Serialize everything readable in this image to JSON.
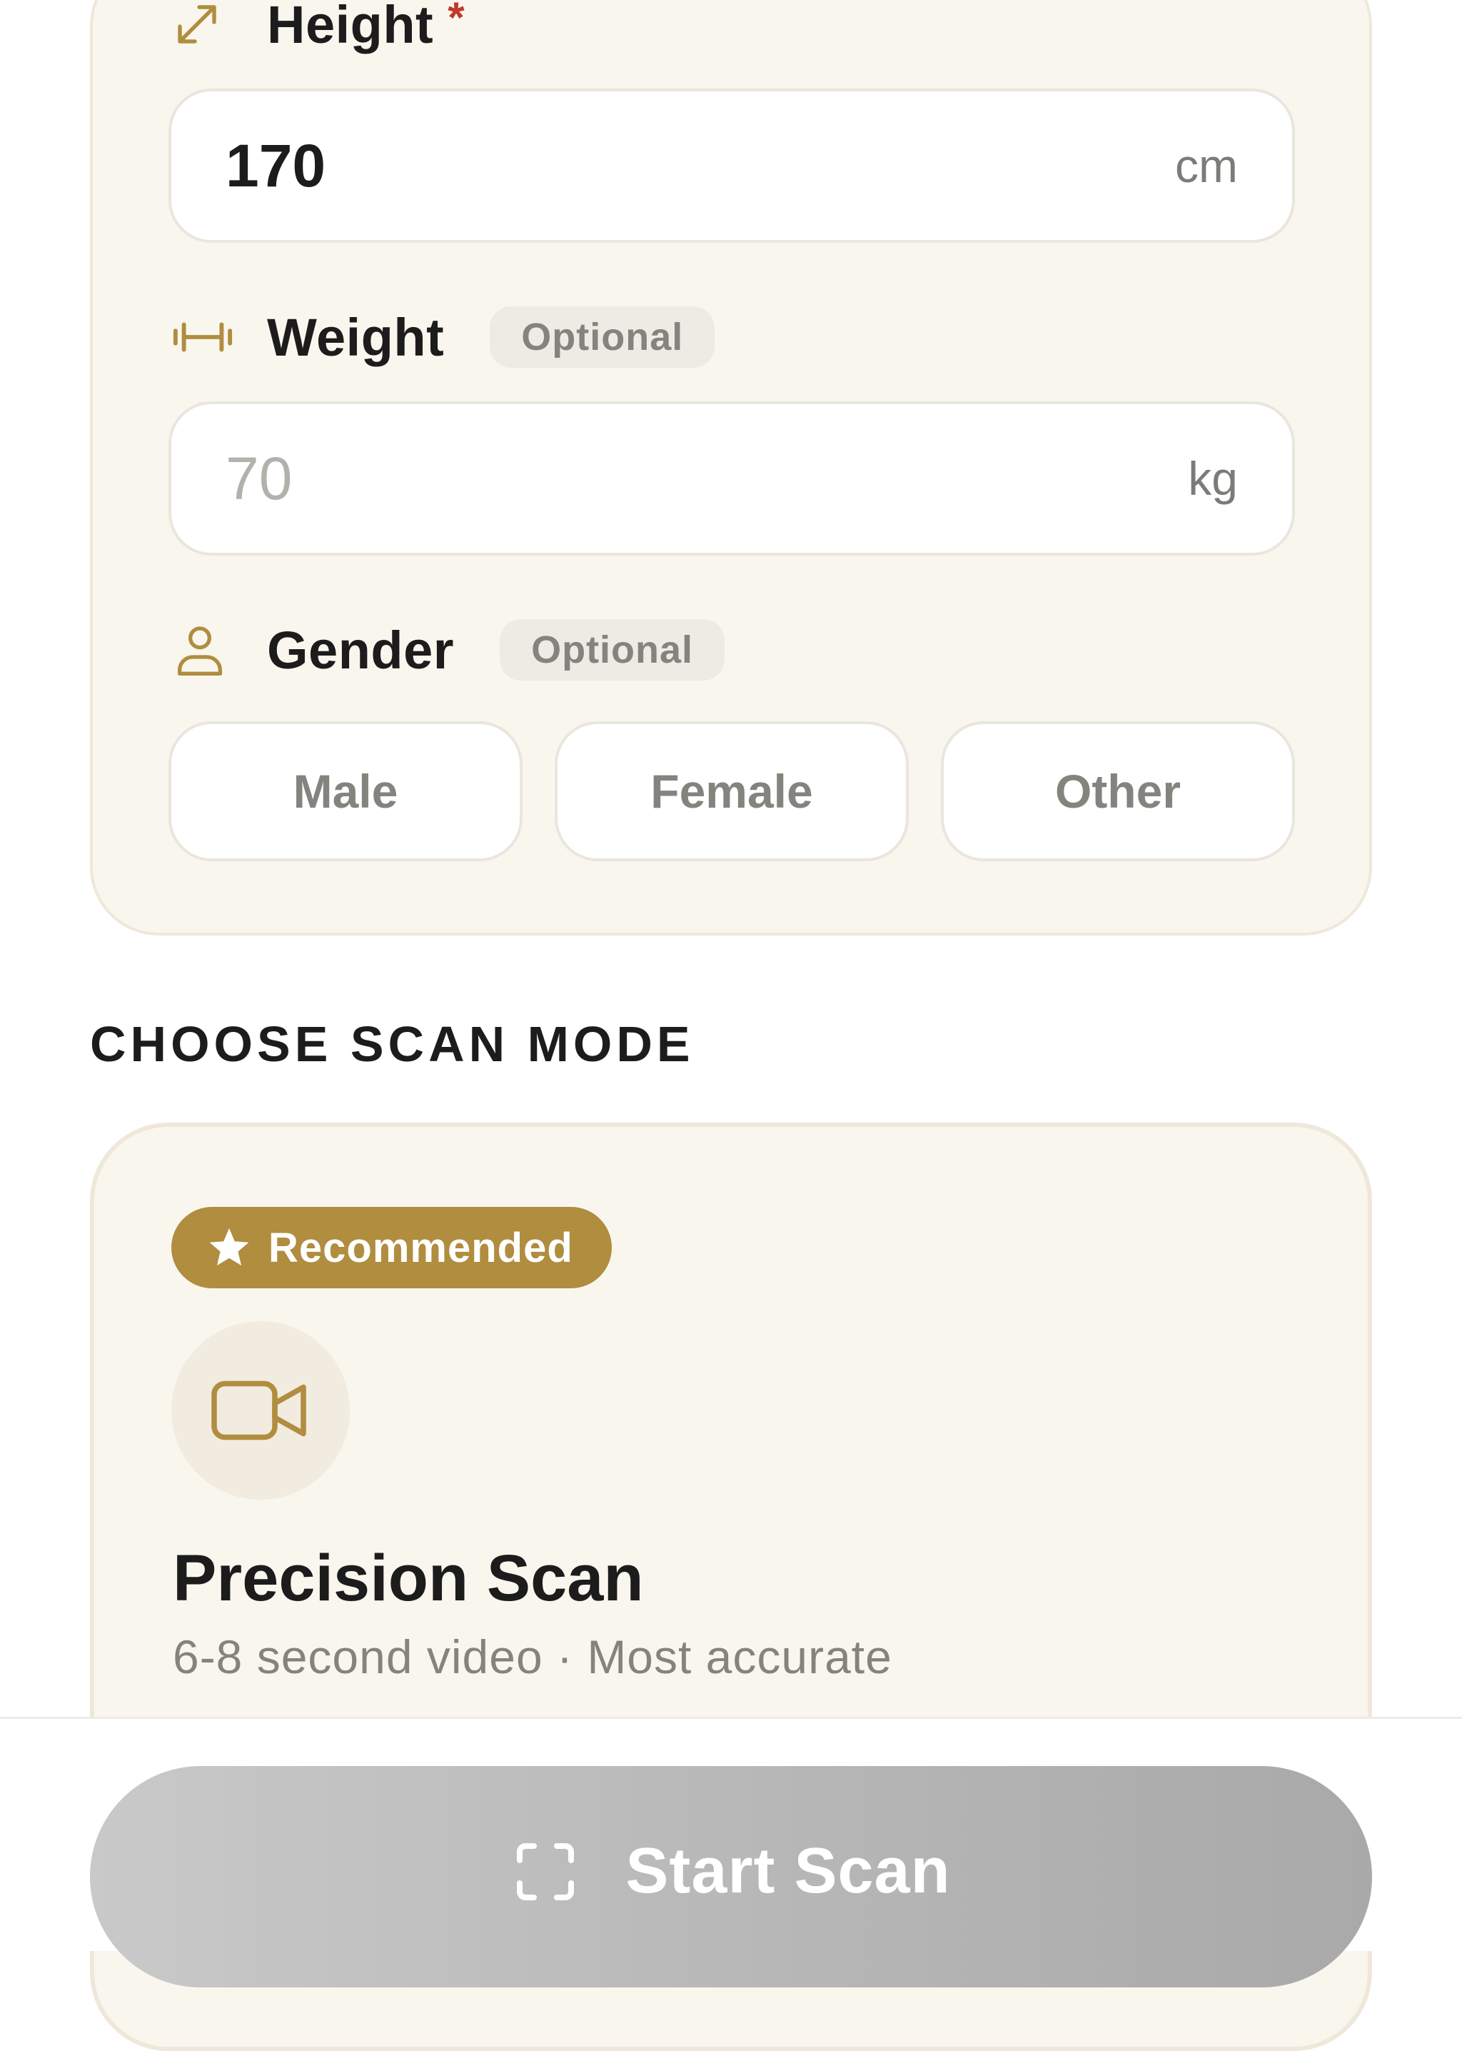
{
  "colors": {
    "accent": "#b08d3f",
    "card_bg": "#f9f6ee",
    "required": "#c0392b",
    "button_disabled": "#b8b8b8"
  },
  "profile": {
    "height": {
      "label": "Height",
      "required_marker": "*",
      "value": "170",
      "unit": "cm",
      "icon": "resize-arrow-icon"
    },
    "weight": {
      "label": "Weight",
      "tag": "Optional",
      "placeholder": "70",
      "unit": "kg",
      "icon": "dumbbell-icon"
    },
    "gender": {
      "label": "Gender",
      "tag": "Optional",
      "icon": "person-icon",
      "options": [
        "Male",
        "Female",
        "Other"
      ]
    }
  },
  "scan_mode": {
    "heading": "CHOOSE SCAN MODE",
    "card": {
      "badge": "Recommended",
      "badge_icon": "star-icon",
      "icon": "video-camera-icon",
      "title": "Precision Scan",
      "subtitle": "6-8 second video · Most accurate"
    }
  },
  "footer": {
    "start_label": "Start Scan",
    "start_icon": "scan-frame-icon"
  }
}
